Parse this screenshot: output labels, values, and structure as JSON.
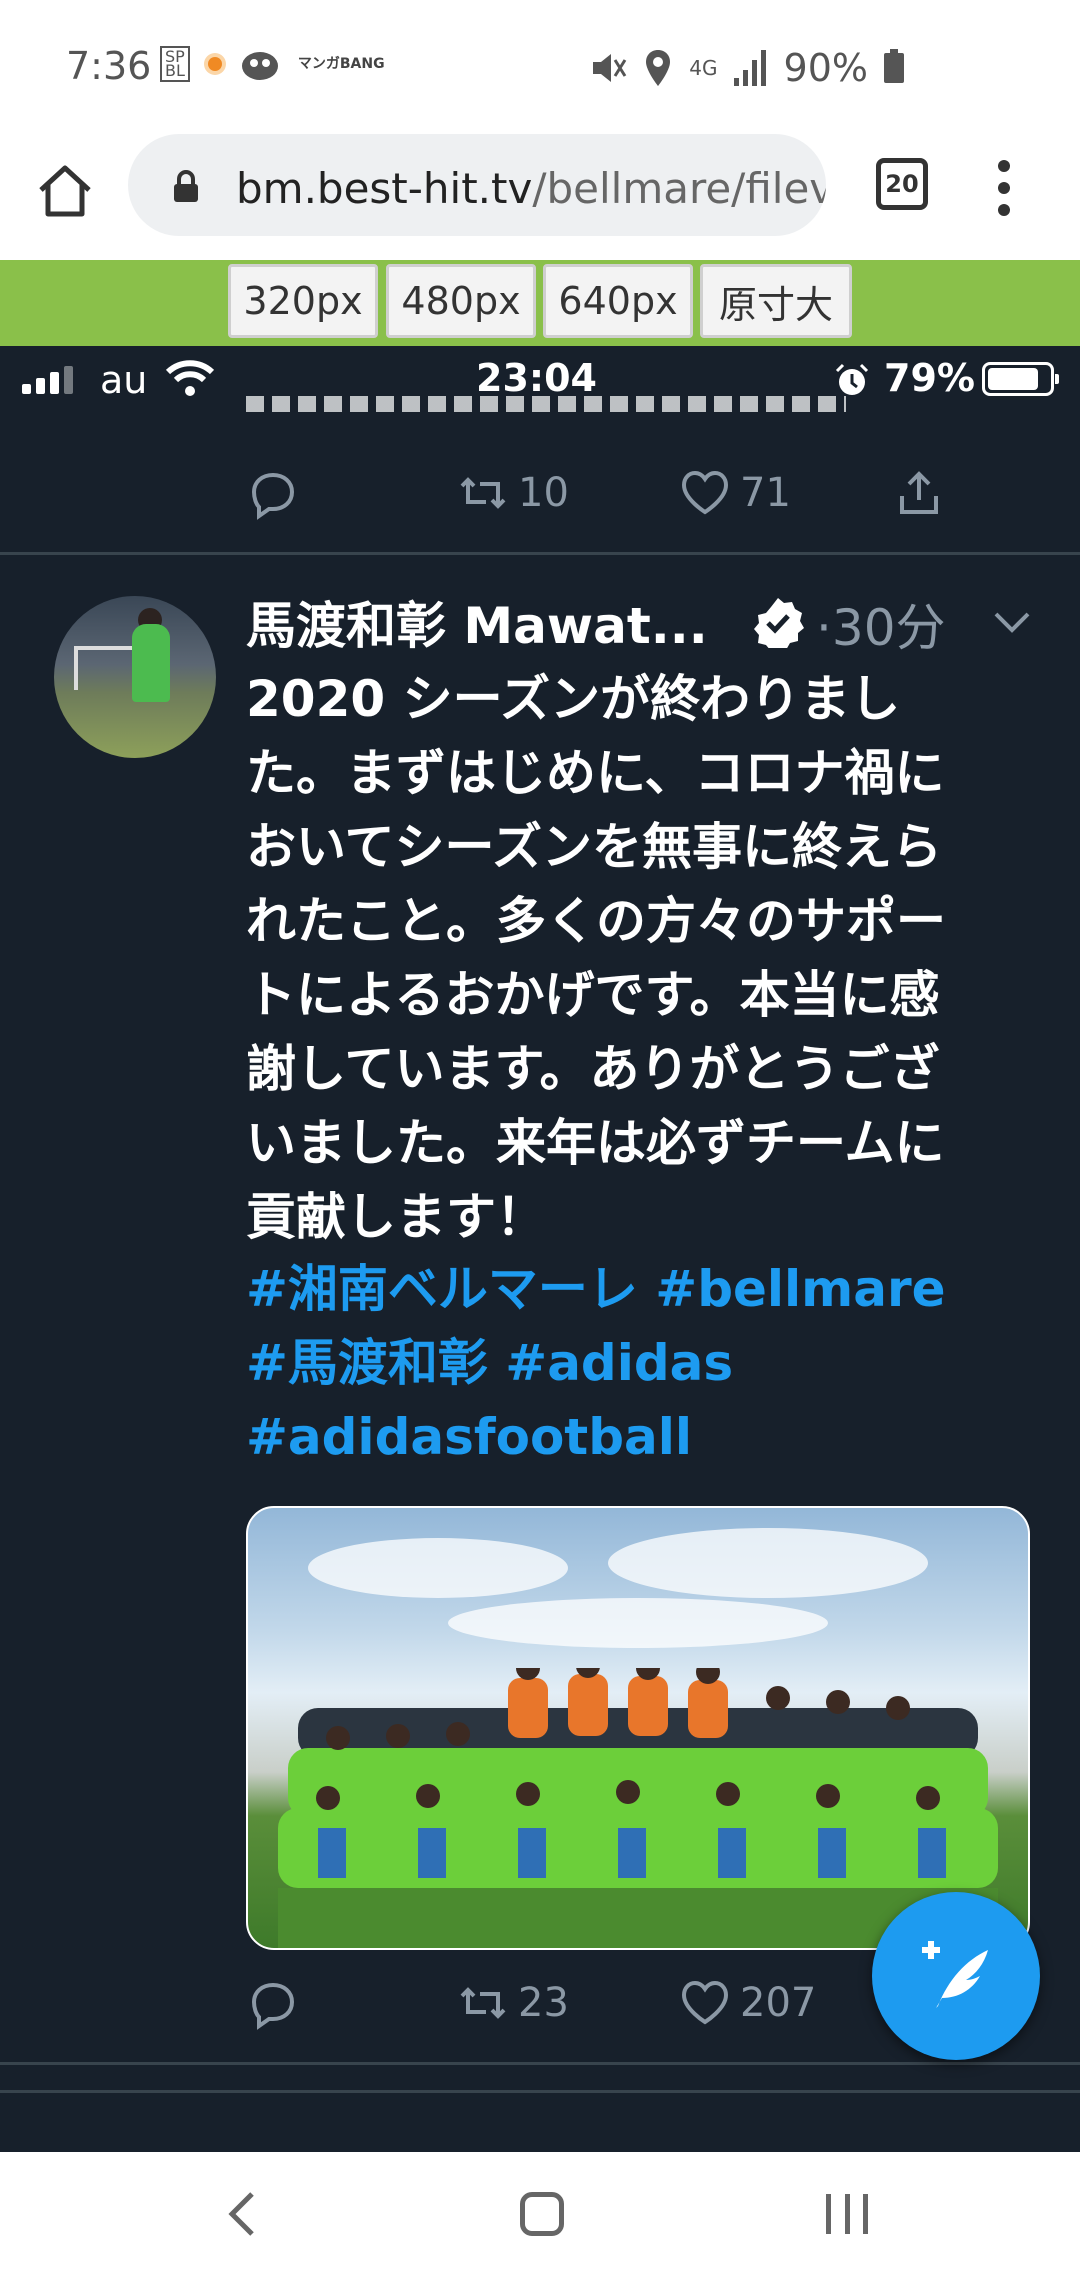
{
  "android_status": {
    "time": "7:36",
    "battery": "90%",
    "network": "4G",
    "mangabang": "マンガBANG"
  },
  "browser": {
    "url_host": "bm.best-hit.tv",
    "url_path": "/bellmare/filev",
    "tab_count": "20"
  },
  "size_buttons": [
    "320px",
    "480px",
    "640px",
    "原寸大"
  ],
  "ios_status": {
    "carrier": "au",
    "clock": "23:04",
    "battery": "79%"
  },
  "prev_tweet": {
    "retweets": "10",
    "likes": "71"
  },
  "tweet": {
    "name": "馬渡和彰 Mawat...",
    "time": "·30分",
    "body_lines": [
      "2020 シーズンが終わりまし",
      "た。まずはじめに、コロナ禍に",
      "おいてシーズンを無事に終えら",
      "れたこと。多くの方々のサポー",
      "トによるおかげです。本当に感",
      "謝しています。ありがとうござ",
      "いました。来年は必ずチームに",
      "貢献します！"
    ],
    "tags_line1": "#湘南ベルマーレ #bellmare",
    "tags_line2": "#馬渡和彰 #adidas",
    "tags_line3": "#adidasfootball",
    "retweets": "23",
    "likes": "207"
  },
  "colors": {
    "twitter_bg": "#17202b",
    "twitter_blue": "#1d9bf0",
    "size_bar_green": "#8ac04a"
  }
}
